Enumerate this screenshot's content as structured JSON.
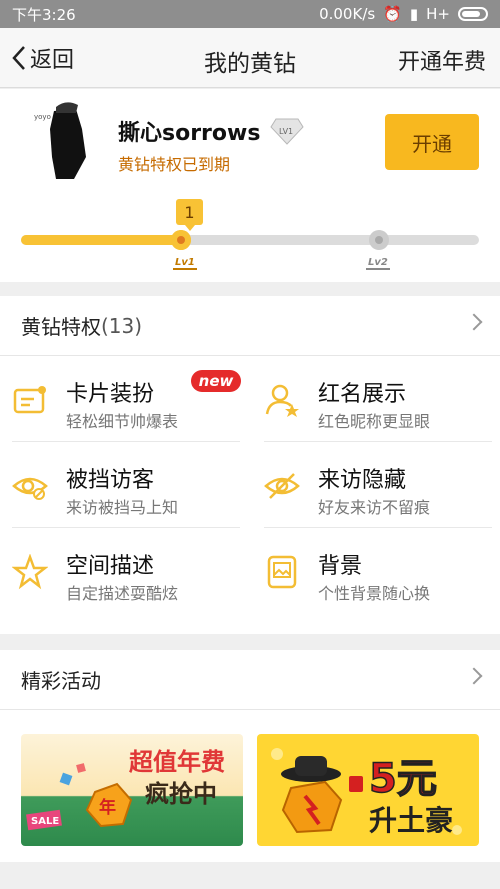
{
  "status_bar": {
    "time": "下午3:26",
    "network_speed": "0.00K/s",
    "network_type": "H+"
  },
  "nav": {
    "back_label": "返回",
    "title": "我的黄钻",
    "action_label": "开通年费"
  },
  "profile": {
    "username": "撕心sorrows",
    "badge_text": "LV1",
    "status_text": "黄钻特权已到期",
    "open_button_label": "开通"
  },
  "level_progress": {
    "current_level": "1",
    "progress_fraction": 0.35,
    "tags": [
      "Lv1",
      "Lv2"
    ]
  },
  "privileges": {
    "header_label": "黄钻特权",
    "count_label": "(13)",
    "items": [
      {
        "title": "卡片装扮",
        "desc": "轻松细节帅爆表",
        "badge": "new",
        "icon": "card-icon"
      },
      {
        "title": "红名展示",
        "desc": "红色昵称更显眼",
        "icon": "user-star-icon"
      },
      {
        "title": "被挡访客",
        "desc": "来访被挡马上知",
        "icon": "eye-blocked-icon"
      },
      {
        "title": "来访隐藏",
        "desc": "好友来访不留痕",
        "icon": "eye-hidden-icon"
      },
      {
        "title": "空间描述",
        "desc": "自定描述耍酷炫",
        "icon": "star-icon"
      },
      {
        "title": "背景",
        "desc": "个性背景随心换",
        "icon": "background-icon"
      }
    ]
  },
  "activities": {
    "header_label": "精彩活动",
    "banners": [
      {
        "line1": "超值年费",
        "line2": "疯抢中",
        "tag": "SALE",
        "coin_text": "年"
      },
      {
        "line1": "5元",
        "line2": "升土豪"
      }
    ]
  },
  "colors": {
    "accent_yellow": "#f8b81f",
    "status_orange": "#c66b00",
    "new_badge_red": "#e52b2b"
  }
}
